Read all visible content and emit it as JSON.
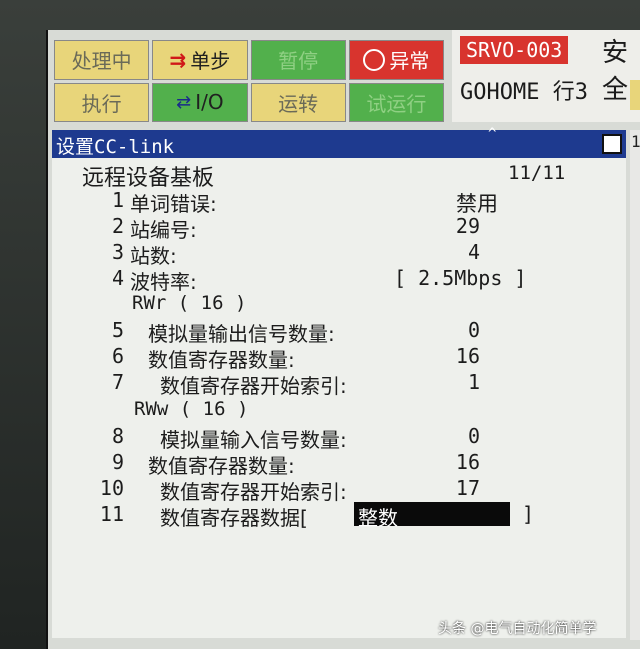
{
  "status": {
    "processing": "处理中",
    "step": "单步",
    "pause": "暂停",
    "abnormal": "异常",
    "execute": "执行",
    "io": "I/O",
    "run": "运转",
    "disabled": "试运行"
  },
  "alarm": {
    "code": "SRVO-003",
    "safety": "安全",
    "program": "GOHOME",
    "line": "行3"
  },
  "title": "设置CC-link",
  "board_name": "远程设备基板",
  "page": "11/11",
  "items": [
    {
      "num": "1",
      "label": "单词错误:",
      "value": "禁用"
    },
    {
      "num": "2",
      "label": "站编号:",
      "value": "29"
    },
    {
      "num": "3",
      "label": "站数:",
      "value": "4"
    },
    {
      "num": "4",
      "label": "波特率:",
      "value": "[ 2.5Mbps ]"
    },
    {
      "num": "5",
      "label": "模拟量输出信号数量:",
      "value": "0"
    },
    {
      "num": "6",
      "label": "数值寄存器数量:",
      "value": "16"
    },
    {
      "num": "7",
      "label": "数值寄存器开始索引:",
      "value": "1"
    },
    {
      "num": "8",
      "label": "模拟量输入信号数量:",
      "value": "0"
    },
    {
      "num": "9",
      "label": "数值寄存器数量:",
      "value": "16"
    },
    {
      "num": "10",
      "label": "数值寄存器开始索引:",
      "value": "17"
    },
    {
      "num": "11",
      "label": "数值寄存器数据[",
      "value": "整数"
    }
  ],
  "rwr_header": "RWr ( 16 )",
  "rww_header": "RWw ( 16 )",
  "close_bracket": "]",
  "side_tab_char": "1",
  "watermark": "头条 @电气自动化简单学"
}
